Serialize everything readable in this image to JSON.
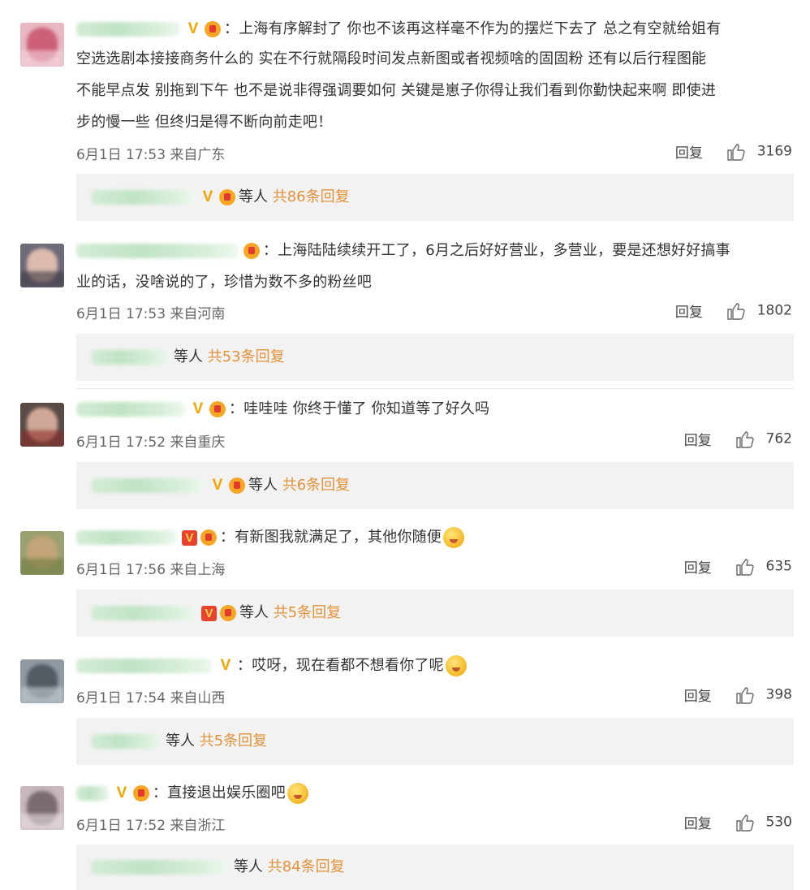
{
  "ui": {
    "reply_label": "回复",
    "others_label": "等人"
  },
  "comments": [
    {
      "lines": [
        "上海有序解封了 你也不该再这样毫不作为的摆烂下去了 总之有空就给姐有",
        "空选选剧本接接商务什么的 实在不行就隔段时间发点新图或者视频啥的固固粉 还有以后行程图能",
        "不能早点发 别拖到下午 也不是说非得强调要如何 关键是崽子你得让我们看到你勤快起来啊 即使进",
        "步的慢一些 但终归是得不断向前走吧！"
      ],
      "time": "6月1日 17:53",
      "location": "来自广东",
      "likes": "3169",
      "replies_total": "共86条回复"
    },
    {
      "lines": [
        "上海陆陆续续开工了，6月之后好好营业，多营业，要是还想好好搞事",
        "业的话，没啥说的了，珍惜为数不多的粉丝吧"
      ],
      "time": "6月1日 17:53",
      "location": "来自河南",
      "likes": "1802",
      "replies_total": "共53条回复"
    },
    {
      "lines": [
        "哇哇哇 你终于懂了 你知道等了好久吗"
      ],
      "time": "6月1日 17:52",
      "location": "来自重庆",
      "likes": "762",
      "replies_total": "共6条回复"
    },
    {
      "lines": [
        "有新图我就满足了，其他你随便"
      ],
      "time": "6月1日 17:56",
      "location": "来自上海",
      "likes": "635",
      "replies_total": "共5条回复"
    },
    {
      "lines": [
        "哎呀，现在看都不想看你了呢"
      ],
      "time": "6月1日 17:54",
      "location": "来自山西",
      "likes": "398",
      "replies_total": "共5条回复"
    },
    {
      "lines": [
        "直接退出娱乐圈吧"
      ],
      "time": "6月1日 17:52",
      "location": "来自浙江",
      "likes": "530",
      "replies_total": "共84条回复"
    }
  ],
  "colors": {
    "accent": "#e3923a",
    "sub_bg": "#f2f2f2",
    "blur_name": "#c8e8cc",
    "badge": "#f0a500"
  }
}
